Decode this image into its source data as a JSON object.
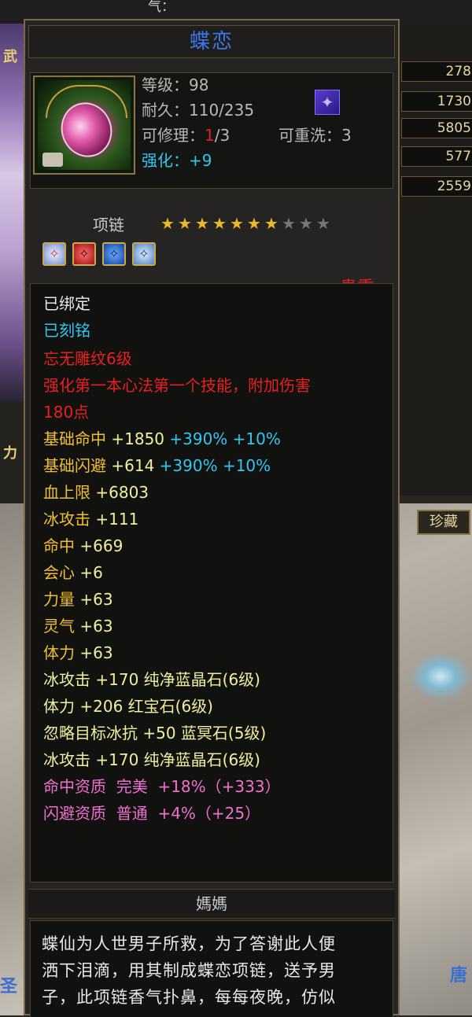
{
  "background": {
    "top_text": "气：",
    "left_words": [
      "武",
      "力"
    ],
    "stats": [
      "278",
      "1730",
      "5805",
      "577",
      "2559"
    ],
    "treasure_button": "珍藏",
    "left_deco": "圣",
    "right_deco": "唐"
  },
  "item": {
    "name": "蝶恋",
    "level_label": "等级：98",
    "durability_label": "耐久：110/235",
    "repair_label": "可修理：",
    "repair_current": "1",
    "repair_max": "/3",
    "rewash_label": "可重洗：3",
    "enhance_label": "强化：",
    "enhance_value": "+9",
    "slot": "项链",
    "stars_total": 10,
    "stars_filled": 7,
    "rarity": "贵重"
  },
  "properties": [
    {
      "text": "已绑定",
      "color": "white"
    },
    {
      "text": "已刻铭",
      "color": "cyan"
    },
    {
      "text": "忘无雕纹6级",
      "color": "red"
    },
    {
      "text": "强化第一本心法第一个技能，附加伤害",
      "color": "red"
    },
    {
      "text": "180点",
      "color": "red"
    }
  ],
  "stats": [
    {
      "name": "基础命中",
      "value": "+1850",
      "pct": "+390%",
      "extra": "+10%"
    },
    {
      "name": "基础闪避",
      "value": "+614",
      "pct": "+390%",
      "extra": "+10%"
    }
  ],
  "bonuses": [
    {
      "name": "血上限",
      "value": "+6803"
    },
    {
      "name": "冰攻击",
      "value": "+111"
    },
    {
      "name": "命中",
      "value": "+669"
    },
    {
      "name": "会心",
      "value": "+6"
    },
    {
      "name": "力量",
      "value": "+63"
    },
    {
      "name": "灵气",
      "value": "+63"
    },
    {
      "name": "体力",
      "value": "+63"
    }
  ],
  "gem_stats": [
    {
      "name": "冰攻击",
      "value": "+170",
      "gem": "纯净蓝晶石(6级)"
    },
    {
      "name": "体力",
      "value": "+206",
      "gem": "红宝石(6级)"
    },
    {
      "name": "忽略目标冰抗",
      "value": "+50",
      "gem": "蓝冥石(5级)"
    },
    {
      "name": "冰攻击",
      "value": "+170",
      "gem": "纯净蓝晶石(6级)"
    }
  ],
  "qualities": [
    {
      "name": "命中资质",
      "grade": "完美",
      "value": "+18%（+333）"
    },
    {
      "name": "闪避资质",
      "grade": "普通",
      "value": "+4%（+25）"
    }
  ],
  "owner": "媽媽",
  "description": [
    "蝶仙为人世男子所救，为了答谢此人便",
    "洒下泪滴，用其制成蝶恋项链，送予男",
    "子，此项链香气扑鼻，每每夜晚，仿似"
  ],
  "colors": {
    "title": "#3b78e7",
    "cyan": "#30c8f0",
    "red": "#e82020",
    "gold": "#f0c030",
    "pink": "#f070d0",
    "border": "#7a6a4a"
  }
}
